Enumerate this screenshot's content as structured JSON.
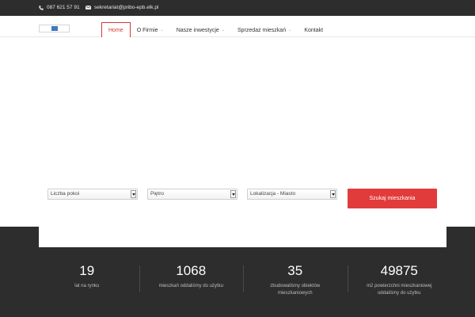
{
  "topbar": {
    "phone": "087 621 57 91",
    "email": "sekretariat@pribo-epb.elk.pl",
    "icons": [
      "phone-icon",
      "envelope-icon"
    ]
  },
  "nav": {
    "items": [
      {
        "label": "Home",
        "active": true,
        "has_dropdown": false
      },
      {
        "label": "O Firmie",
        "active": false,
        "has_dropdown": true
      },
      {
        "label": "Nasze inwestycje",
        "active": false,
        "has_dropdown": true
      },
      {
        "label": "Sprzedaż mieszkań",
        "active": false,
        "has_dropdown": true
      },
      {
        "label": "Kontakt",
        "active": false,
        "has_dropdown": false
      }
    ],
    "chevron": "⌄"
  },
  "search": {
    "rooms_select": "Liczba pokoi",
    "floor_select": "Piętro",
    "location_select": "Lokalizacja - Miasto",
    "submit_label": "Szukaj mieszkania"
  },
  "stats": [
    {
      "value": "19",
      "label": "lat na rynku"
    },
    {
      "value": "1068",
      "label": "mieszkań oddaliśmy do użytku"
    },
    {
      "value": "35",
      "label": "zbudowaliśmy obiektów mieszkaniowych"
    },
    {
      "value": "49875",
      "label": "m2 powierzchni mieszkaniowej oddaliśmy do użytku"
    }
  ],
  "colors": {
    "accent": "#e23b3b",
    "dark_bg": "#2d2d2d",
    "logo_blue": "#3f79c2"
  }
}
